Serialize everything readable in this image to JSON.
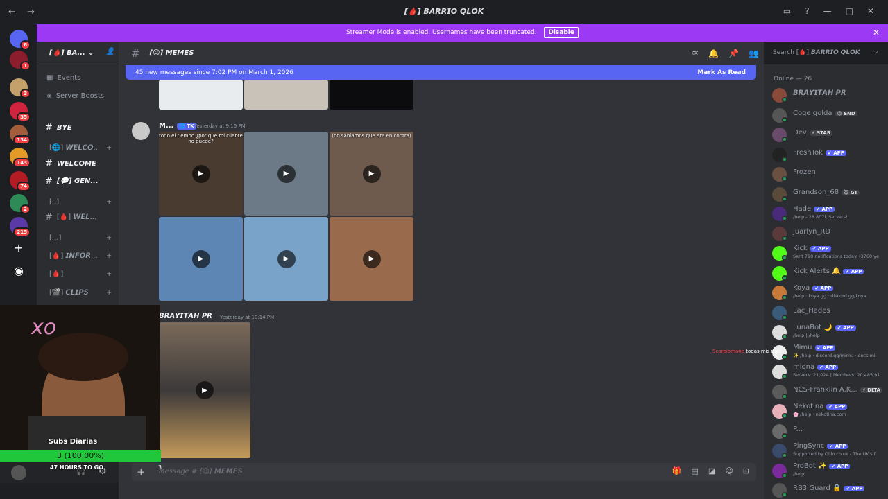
{
  "window": {
    "title": "[🩸] 𝘽𝘼𝙍𝙍𝙄𝙊 𝙌𝙇𝙊𝙆",
    "nav": "← →"
  },
  "banner": {
    "text": "Streamer Mode is enabled. Usernames have been truncated.",
    "button": "Disable",
    "close": "✕"
  },
  "server": {
    "name": "[🩸] 𝘽𝘼..."
  },
  "servers": [
    {
      "badge": "6",
      "color": "#5865f2"
    },
    {
      "badge": "1",
      "color": "#8b1d2c"
    },
    {
      "badge": "3",
      "color": "#c4a06a"
    },
    {
      "badge": "35",
      "color": "#d1233d"
    },
    {
      "badge": "134",
      "color": "#a35d3b"
    },
    {
      "badge": "143",
      "color": "#e39b27"
    },
    {
      "badge": "74",
      "color": "#b21c22"
    },
    {
      "badge": "2",
      "color": "#2e8b57"
    },
    {
      "badge": "215",
      "color": "#5b3aa8"
    }
  ],
  "sidebar": {
    "events": "Events",
    "boosts": "Server Boosts",
    "channels": [
      {
        "label": "𝘽𝙔𝙀",
        "hash": "#"
      },
      {
        "label": "[🌐] 𝙒𝙀𝙇𝘾𝙊...",
        "hash": ""
      },
      {
        "label": "𝙒𝙀𝙇𝘾𝙊𝙈𝙀",
        "hash": "#"
      },
      {
        "label": "[💬] 𝙂𝙀𝙉...",
        "hash": "#"
      },
      {
        "label": "[..]",
        "hash": ""
      },
      {
        "label": "[🩸] 𝙒𝙀𝙇...",
        "hash": "#"
      },
      {
        "label": "[...]",
        "hash": ""
      },
      {
        "label": "[🩸] 𝙄𝙉𝙁𝙊𝙍...",
        "hash": ""
      },
      {
        "label": "[🩸]",
        "hash": ""
      },
      {
        "label": "[🎬] 𝘾𝙇𝙄𝙋𝙎",
        "hash": ""
      }
    ]
  },
  "channel": {
    "name": "[😉] 𝙈𝙀𝙈𝙀𝙎",
    "hash": "#"
  },
  "search": {
    "placeholder": "Search [🩸] 𝘽𝘼𝙍𝙍𝙄𝙊 𝙌𝙇𝙊𝙆"
  },
  "new_messages": {
    "text": "45 new messages since 7:02 PM on March 1, 2026",
    "action": "Mark As Read"
  },
  "messages": [
    {
      "author": "M...",
      "tag": "🌐 TK",
      "time": "Yesterday at 9:16 PM",
      "tiles": [
        {
          "caption": "todo el tiempo ¿por qué mi cliente no puede?",
          "color": "#4a3b30"
        },
        {
          "caption": "",
          "color": "#6b7a86"
        },
        {
          "caption": "(no sabíamos que era en contra)",
          "color": "#6f5a4e"
        },
        {
          "caption": "",
          "color": "#5d86b5"
        },
        {
          "caption": "",
          "color": "#7aa3c9"
        },
        {
          "caption": "",
          "color": "#9a6a4c"
        }
      ]
    },
    {
      "author": "𝘽𝙍𝘼𝙔𝙄𝙏𝘼𝙃 𝙋𝙍",
      "time": "Yesterday at 10:14 PM"
    }
  ],
  "composer": {
    "placeholder": "Message # [😉] 𝙈𝙀𝙈𝙀𝙎",
    "plus": "+"
  },
  "members": {
    "header": "Online — 26",
    "list": [
      {
        "name": "𝘽𝙍𝘼𝙔𝙄𝙏𝘼𝙃 𝙋𝙍",
        "badge": "",
        "sub": "",
        "color": "#8a4a3a"
      },
      {
        "name": "Coge golda",
        "badge": "😡 END",
        "sub": "",
        "color": "#555"
      },
      {
        "name": "Dev",
        "badge": "⚡ STAR",
        "sub": "",
        "color": "#6a4a6a"
      },
      {
        "name": "FreshTok",
        "badge": "✔ APP",
        "sub": "",
        "color": "#222"
      },
      {
        "name": "Frozen",
        "badge": "",
        "sub": "",
        "color": "#6a5040"
      },
      {
        "name": "Grandson_68",
        "badge": "😺 GT",
        "sub": "",
        "color": "#5a4a3a"
      },
      {
        "name": "Hade",
        "badge": "✔ APP",
        "sub": "/help - 28.807k Servers!",
        "color": "#4a2a7a"
      },
      {
        "name": "juarlyn_RD",
        "badge": "",
        "sub": "",
        "color": "#5a3a3a"
      },
      {
        "name": "Kick",
        "badge": "✔ APP",
        "sub": "Sent 790 notifications today. (3760 ye",
        "color": "#53fc18"
      },
      {
        "name": "Kick Alerts 🔔",
        "badge": "✔ APP",
        "sub": "",
        "color": "#53fc18"
      },
      {
        "name": "Koya",
        "badge": "✔ APP",
        "sub": "/help · koya.gg · discord.gg/koya",
        "color": "#c87a3a"
      },
      {
        "name": "Lac_Hades",
        "badge": "",
        "sub": "",
        "color": "#3a5a7a"
      },
      {
        "name": "LunaBot 🌙",
        "badge": "✔ APP",
        "sub": "/help | /help",
        "color": "#ddd"
      },
      {
        "name": "Mimu",
        "badge": "✔ APP",
        "sub": "✨ /help · discord.gg/mimu · docs.mi",
        "color": "#eee"
      },
      {
        "name": "miona",
        "badge": "✔ APP",
        "sub": "Servers: 21,024 | Members: 20,485,91",
        "color": "#ddd"
      },
      {
        "name": "NCS-Franklin A.K...",
        "badge": "⚡ DLTA",
        "sub": "",
        "color": "#5a5a5a"
      },
      {
        "name": "Nekotina",
        "badge": "✔ APP",
        "sub": "🌸 /help · nekotina.com",
        "color": "#e8b0b8"
      },
      {
        "name": "P...",
        "badge": "",
        "sub": "",
        "color": "#6a6a6a"
      },
      {
        "name": "PingSync",
        "badge": "✔ APP",
        "sub": "Supported by Olilo.co.uk - The UK's f",
        "color": "#3a4a6a"
      },
      {
        "name": "ProBot ✨",
        "badge": "✔ APP",
        "sub": "/help",
        "color": "#7a2a9a"
      },
      {
        "name": "RB3 Guard 🔒",
        "badge": "✔ APP",
        "sub": "",
        "color": "#555"
      }
    ]
  },
  "stream": {
    "subs_label": "Subs Diarias",
    "subs_value": "3 (100.00%)",
    "hours": "47 HOURS TO GO",
    "count": "3",
    "overlay_name": "Scorpiomane",
    "overlay_msg": "todas mis mas"
  }
}
